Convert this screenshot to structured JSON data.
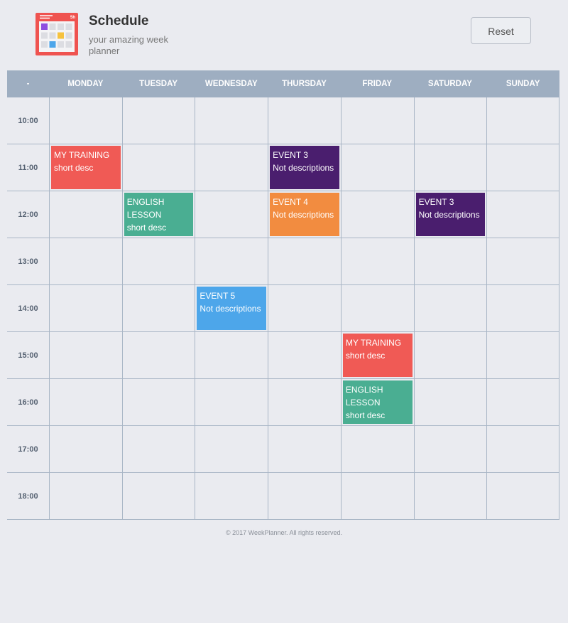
{
  "header": {
    "title": "Schedule",
    "subtitle": "your amazing week planner",
    "reset_label": "Reset",
    "logo_badge": "5h"
  },
  "columns": [
    "-",
    "MONDAY",
    "TUESDAY",
    "WEDNESDAY",
    "THURSDAY",
    "FRIDAY",
    "SATURDAY",
    "SUNDAY"
  ],
  "times": [
    "10:00",
    "11:00",
    "12:00",
    "13:00",
    "14:00",
    "15:00",
    "16:00",
    "17:00",
    "18:00"
  ],
  "colors": {
    "red": "#f05a55",
    "green": "#4aae92",
    "purple": "#4a1e6e",
    "orange": "#f28c40",
    "blue": "#4da6ea"
  },
  "events": [
    {
      "day": 1,
      "slot": 1,
      "title": "MY TRAINING",
      "desc": "short desc",
      "color": "#f05a55"
    },
    {
      "day": 2,
      "slot": 2,
      "title": "ENGLISH LESSON",
      "desc": "short desc",
      "color": "#4aae92"
    },
    {
      "day": 3,
      "slot": 4,
      "title": "EVENT 5",
      "desc": "Not descriptions",
      "color": "#4da6ea"
    },
    {
      "day": 4,
      "slot": 1,
      "title": "EVENT 3",
      "desc": "Not descriptions",
      "color": "#4a1e6e"
    },
    {
      "day": 4,
      "slot": 2,
      "title": "EVENT 4",
      "desc": "Not descriptions",
      "color": "#f28c40"
    },
    {
      "day": 5,
      "slot": 5,
      "title": "MY TRAINING",
      "desc": "short desc",
      "color": "#f05a55"
    },
    {
      "day": 5,
      "slot": 6,
      "title": "ENGLISH LESSON",
      "desc": "short desc",
      "color": "#4aae92"
    },
    {
      "day": 6,
      "slot": 2,
      "title": "EVENT 3",
      "desc": "Not descriptions",
      "color": "#4a1e6e"
    }
  ],
  "footer": "© 2017 WeekPlanner. All rights reserved."
}
